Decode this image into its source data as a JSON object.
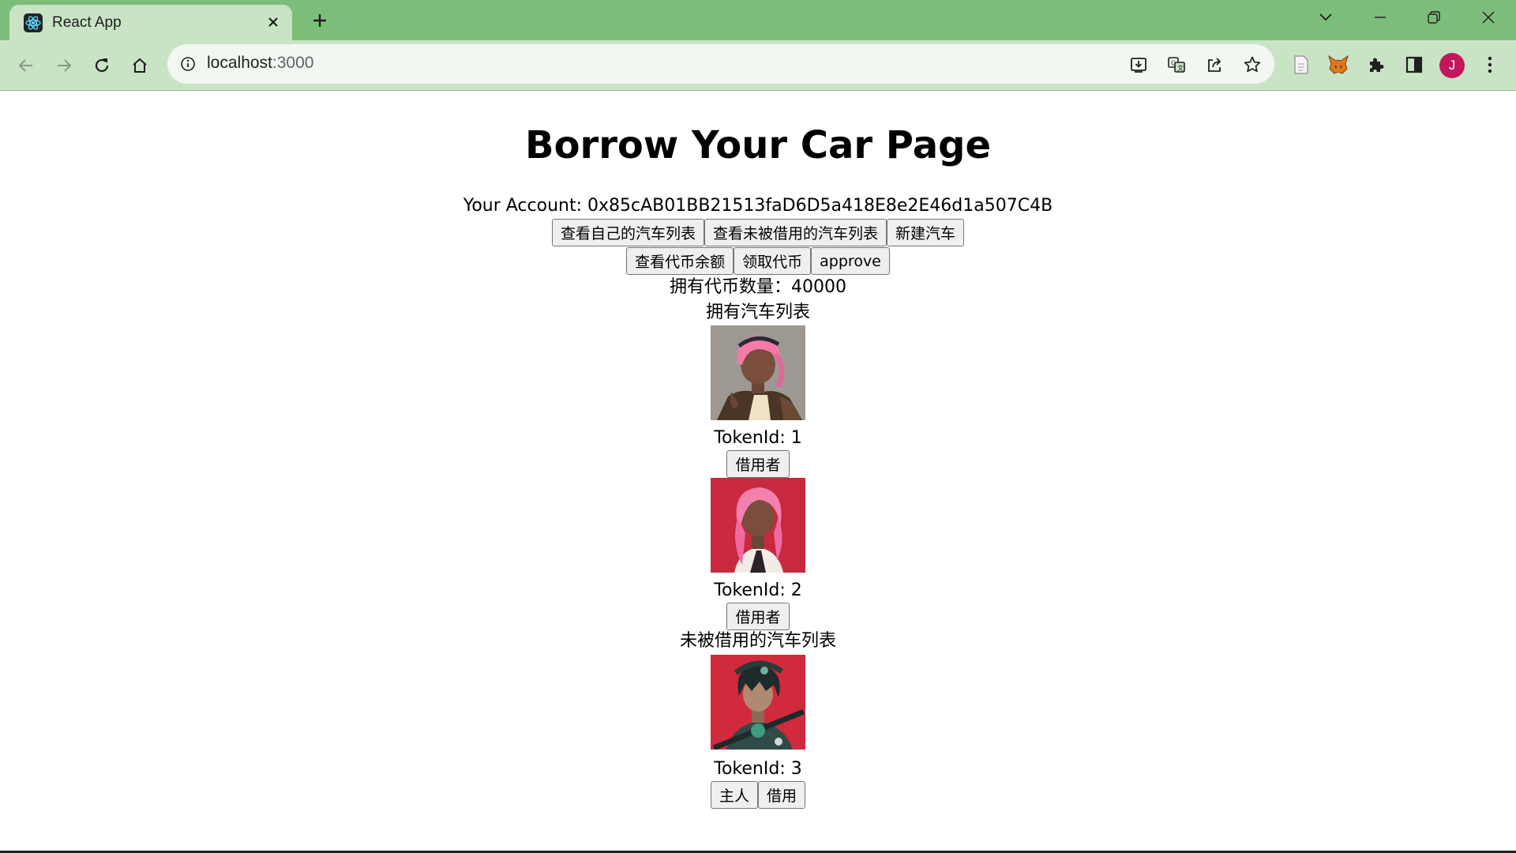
{
  "browser": {
    "tab_title": "React App",
    "url_host": "localhost",
    "url_port": ":3000",
    "avatar_letter": "J"
  },
  "page": {
    "title": "Borrow Your Car Page",
    "account_line": "Your Account: 0x85cAB01BB21513faD6D5a418E8e2E46d1a507C4B",
    "buttons_row1": [
      "查看自己的汽车列表",
      "查看未被借用的汽车列表",
      "新建汽车"
    ],
    "buttons_row2": [
      "查看代币余额",
      "领取代币",
      "approve"
    ],
    "token_balance": "拥有代币数量：40000",
    "owned_list_title": "拥有汽车列表",
    "owned_cars": [
      {
        "token_label": "TokenId: 1",
        "button": "借用者",
        "image": "anime girl, pink hair, grey background"
      },
      {
        "token_label": "TokenId: 2",
        "button": "借用者",
        "image": "anime girl, pink hair, red background"
      }
    ],
    "available_list_title": "未被借用的汽车列表",
    "available_cars": [
      {
        "token_label": "TokenId: 3",
        "buttons": [
          "主人",
          "借用"
        ],
        "image": "anime character, dark hair, red background"
      }
    ]
  },
  "colors": {
    "tabbar": "#7dbd7b",
    "toolbar": "#c8e4c4",
    "avatar": "#c2185b"
  }
}
